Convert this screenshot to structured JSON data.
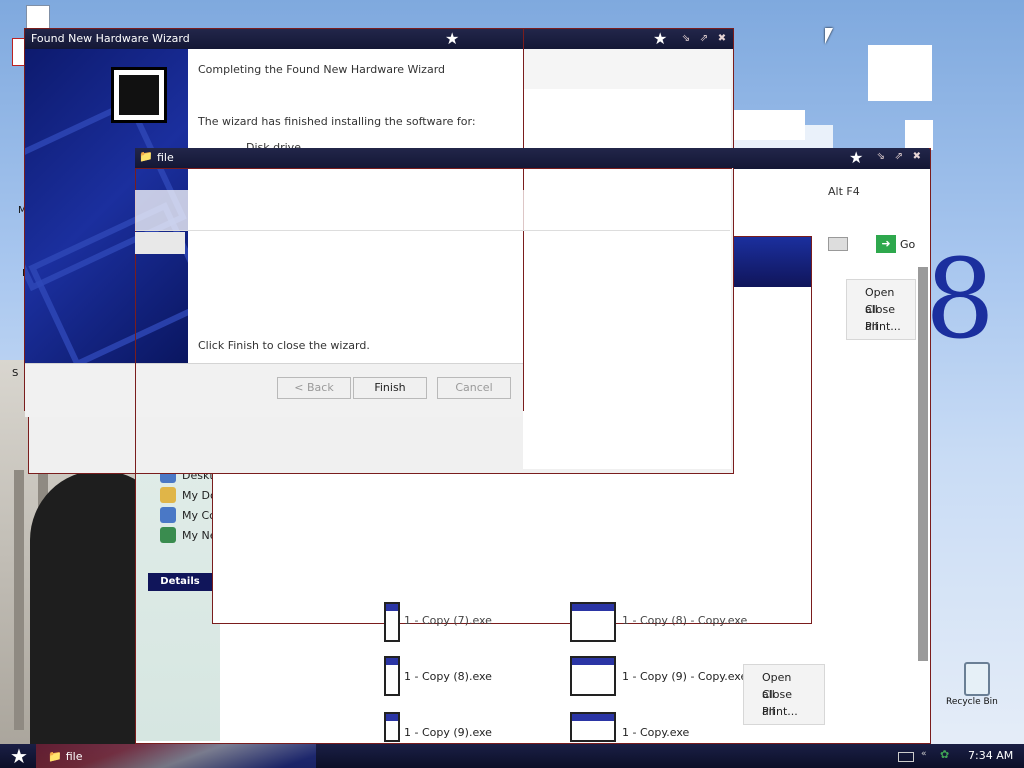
{
  "wizard": {
    "title": "Found New Hardware Wizard",
    "heading": "Completing the Found New Hardware Wizard",
    "line1": "The wizard has finished installing the software for:",
    "device": "Disk drive",
    "close_hint": "Click Finish to close the wizard.",
    "back": "< Back",
    "finish": "Finish",
    "cancel": "Cancel"
  },
  "file_window": {
    "title": "file"
  },
  "explorer": {
    "go": "Go",
    "alt_text": "Alt F4",
    "details": "Details",
    "tree": [
      "Deskt",
      "My Dc",
      "My Cc",
      "My Ne"
    ]
  },
  "context_menu_top": [
    "Open all",
    "Close all",
    "Print..."
  ],
  "context_menu_bottom": [
    "Open all",
    "Close all",
    "Print..."
  ],
  "files": [
    {
      "name": "1 - Copy (7).exe"
    },
    {
      "name": "1 - Copy (8) - Copy.exe"
    },
    {
      "name": "1 - Copy (8).exe"
    },
    {
      "name": "1 - Copy (9) - Copy.exe"
    },
    {
      "name": "1 - Copy (9).exe"
    },
    {
      "name": "1 - Copy.exe"
    }
  ],
  "desktop": {
    "recycle_bin": "Recycle Bin",
    "side_letters": [
      "M",
      "M",
      "I",
      "S"
    ]
  },
  "taskbar": {
    "task_label": "file",
    "time": "7:34 AM"
  },
  "colors": {
    "title_bar": "#1a1d3e",
    "window_border": "#7a1d1d",
    "wizard_panel": "#1b2f9e"
  }
}
